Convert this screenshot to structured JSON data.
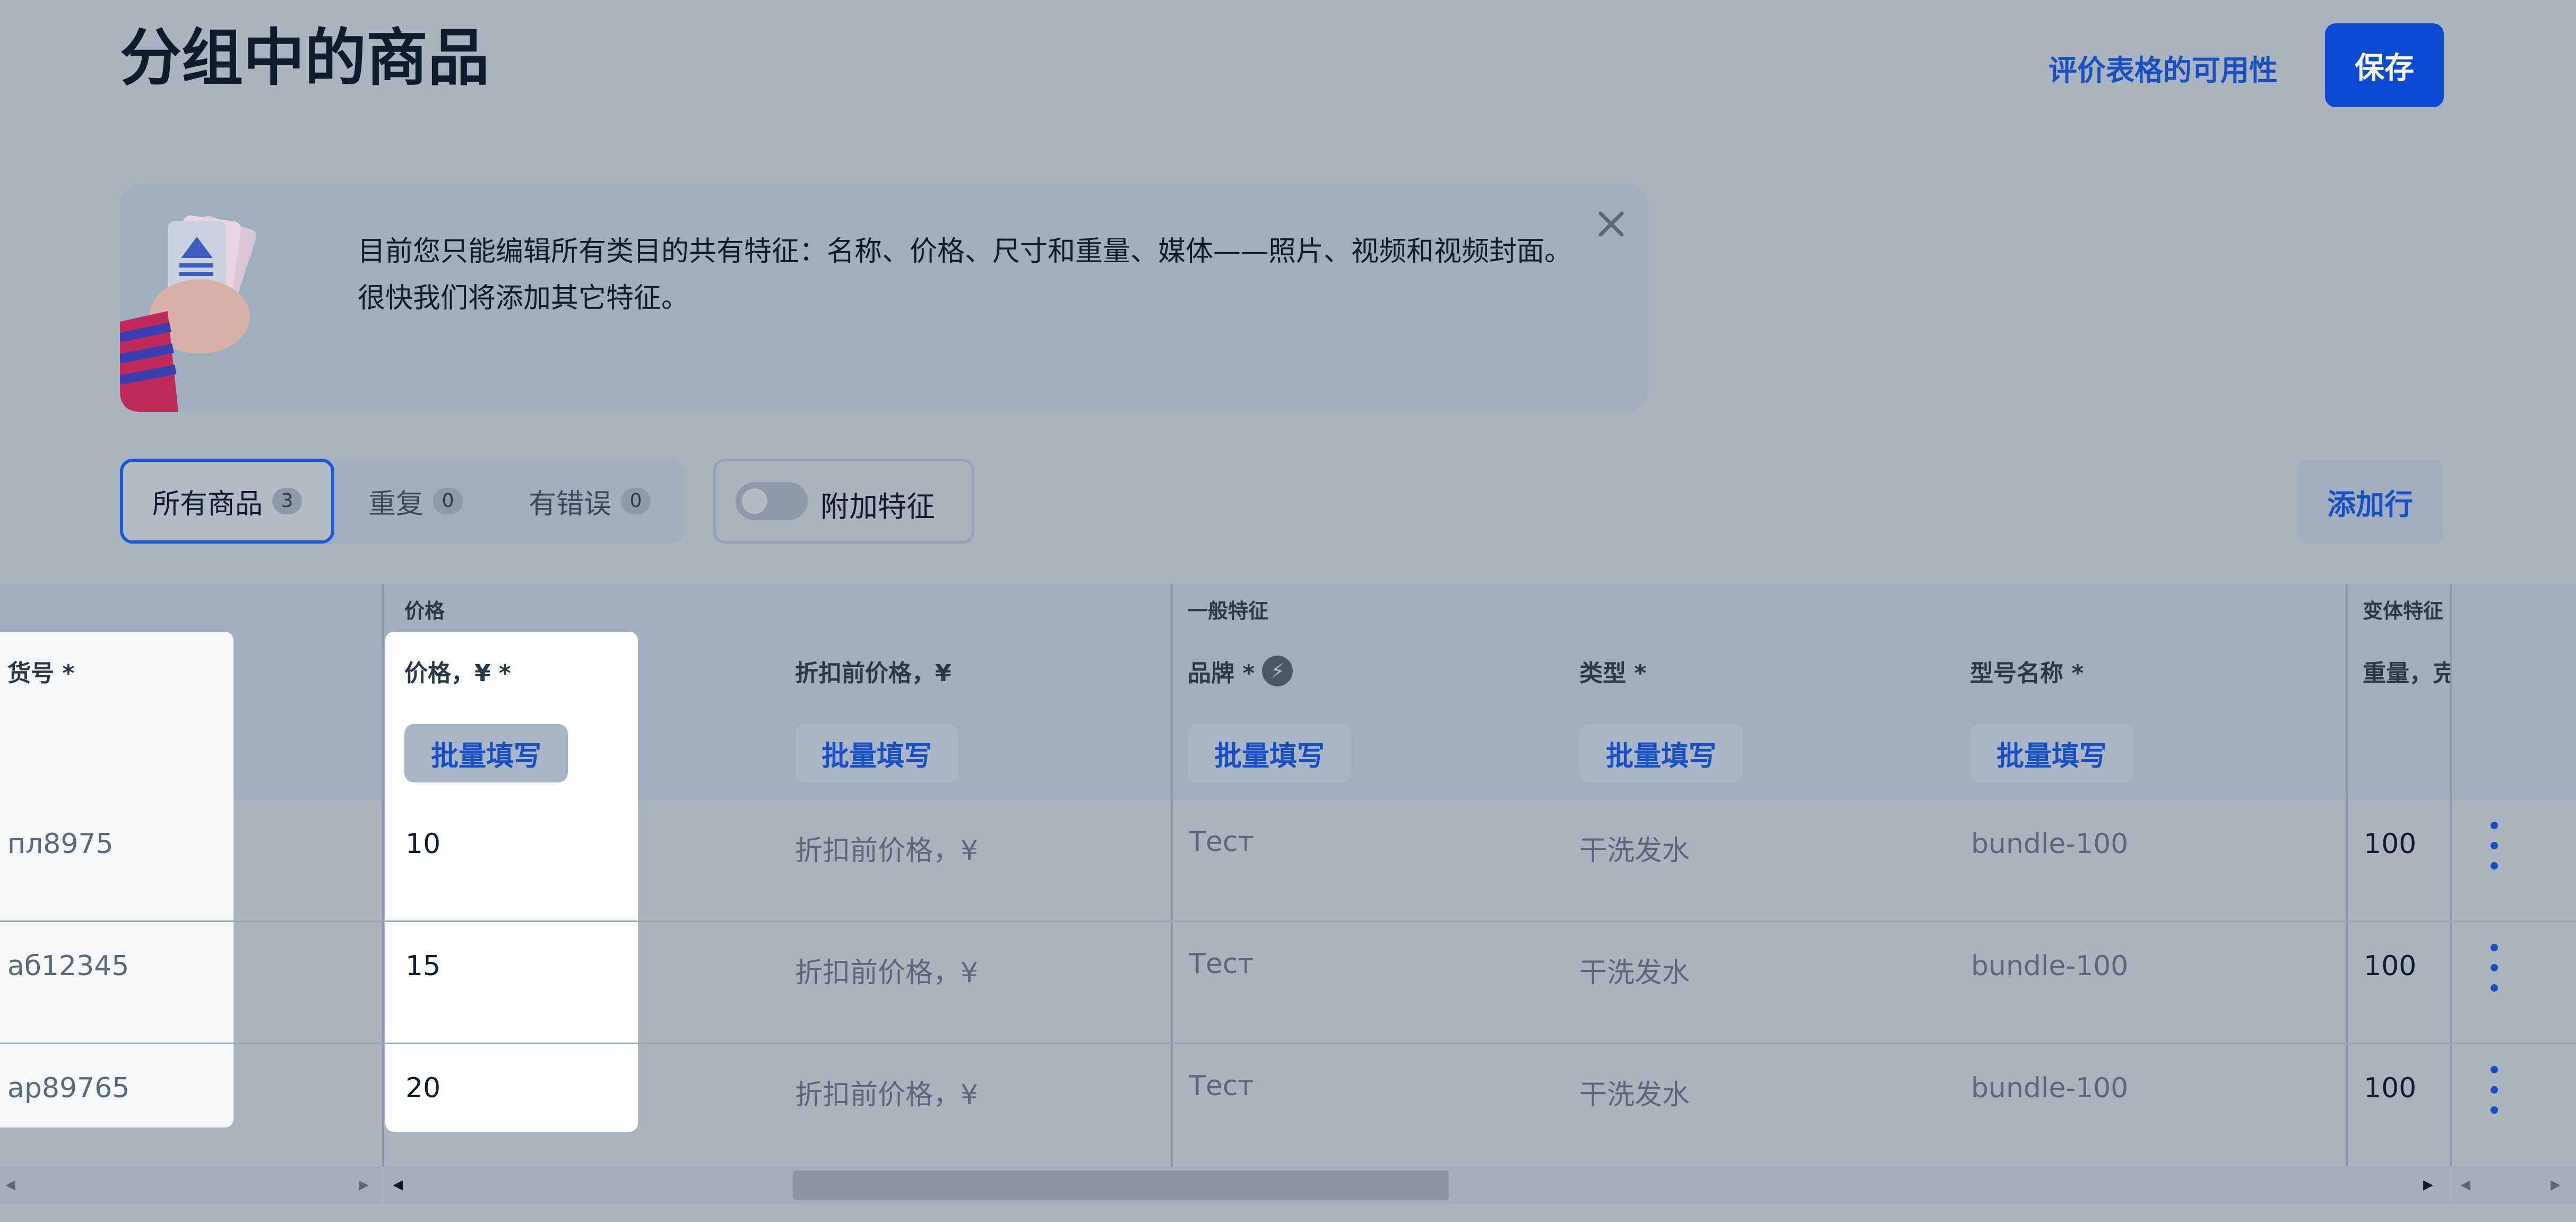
{
  "header": {
    "title": "分组中的商品",
    "eval_link": "评价表格的可用性",
    "save_label": "保存"
  },
  "notice": {
    "text": "目前您只能编辑所有类目的共有特征：名称、价格、尺寸和重量、媒体——照片、视频和视频封面。很快我们将添加其它特征。"
  },
  "filters": {
    "tabs": [
      {
        "label": "所有商品",
        "count": "3"
      },
      {
        "label": "重复",
        "count": "0"
      },
      {
        "label": "有错误",
        "count": "0"
      }
    ],
    "extra_toggle_label": "附加特征",
    "add_row_label": "添加行"
  },
  "table": {
    "groups": {
      "price": "价格",
      "general": "一般特征",
      "variant": "变体特征"
    },
    "columns": {
      "sku": "货号 *",
      "price": "价格，¥ *",
      "old_price": "折扣前价格，¥",
      "brand": "品牌 *",
      "type": "类型 *",
      "model": "型号名称 *",
      "weight": "重量，克"
    },
    "bulk_fill_label": "批量填写",
    "rows": [
      {
        "sku": "пл8975",
        "price": "10",
        "old_price": "折扣前价格，¥",
        "brand": "Тест",
        "type": "干洗发水",
        "model": "bundle-100",
        "weight": "100"
      },
      {
        "sku": "аб12345",
        "price": "15",
        "old_price": "折扣前价格，¥",
        "brand": "Тест",
        "type": "干洗发水",
        "model": "bundle-100",
        "weight": "100"
      },
      {
        "sku": "ар89765",
        "price": "20",
        "old_price": "折扣前价格，¥",
        "brand": "Тест",
        "type": "干洗发水",
        "model": "bundle-100",
        "weight": "100"
      }
    ]
  },
  "colors": {
    "accent": "#0c4bd1",
    "overlay": "#aab4be",
    "link": "#1a4fc4"
  }
}
